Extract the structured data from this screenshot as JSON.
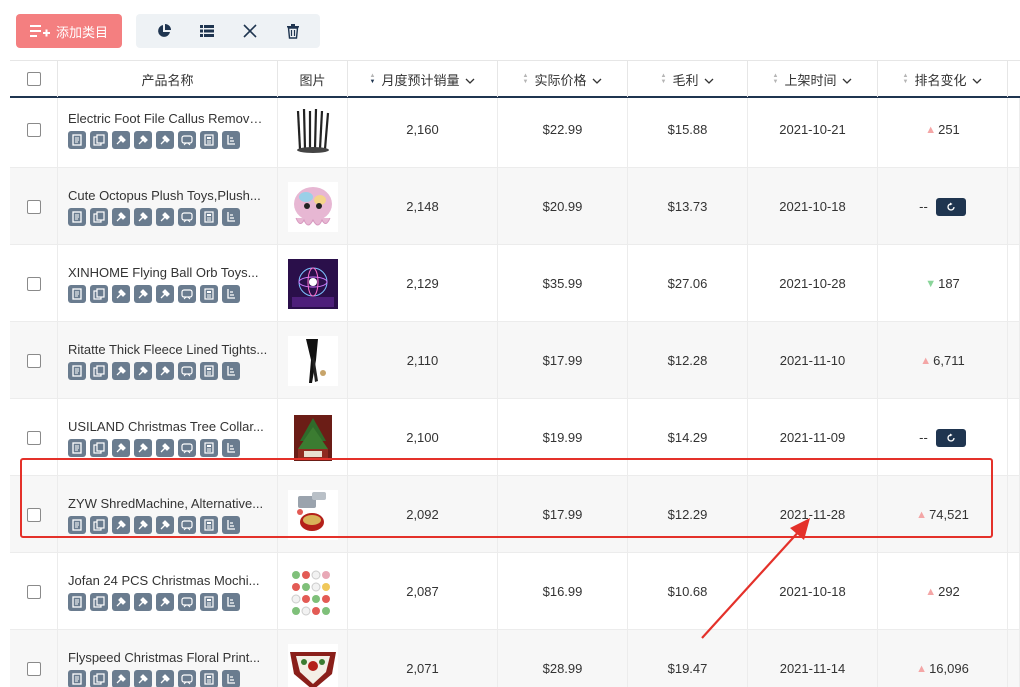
{
  "toolbar": {
    "add_label": "添加类目",
    "icons": [
      "pie-chart-icon",
      "list-icon",
      "close-icon",
      "trash-icon"
    ]
  },
  "table": {
    "headers": {
      "name": "产品名称",
      "image": "图片",
      "monthly_sales": "月度预计销量",
      "price": "实际价格",
      "gross_profit": "毛利",
      "listed_date": "上架时间",
      "rank_change": "排名变化"
    },
    "rows": [
      {
        "title": "Electric Foot File Callus Remover...",
        "sales": "2,160",
        "price": "$22.99",
        "profit": "$15.88",
        "date": "2021-10-21",
        "rank_dir": "up",
        "rank": "251",
        "img": "brushes"
      },
      {
        "title": "Cute Octopus Plush Toys,Plush...",
        "sales": "2,148",
        "price": "$20.99",
        "profit": "$13.73",
        "date": "2021-10-18",
        "rank_dir": "none",
        "rank": "--",
        "img": "plush"
      },
      {
        "title": "XINHOME Flying Ball Orb Toys...",
        "sales": "2,129",
        "price": "$35.99",
        "profit": "$27.06",
        "date": "2021-10-28",
        "rank_dir": "down",
        "rank": "187",
        "img": "orb"
      },
      {
        "title": "Ritatte Thick Fleece Lined Tights...",
        "sales": "2,110",
        "price": "$17.99",
        "profit": "$12.28",
        "date": "2021-11-10",
        "rank_dir": "up",
        "rank": "6,711",
        "img": "tights"
      },
      {
        "title": "USILAND Christmas Tree Collar...",
        "sales": "2,100",
        "price": "$19.99",
        "profit": "$14.29",
        "date": "2021-11-09",
        "rank_dir": "none",
        "rank": "--",
        "img": "tree"
      },
      {
        "title": "ZYW ShredMachine, Alternative...",
        "sales": "2,092",
        "price": "$17.99",
        "profit": "$12.29",
        "date": "2021-11-28",
        "rank_dir": "up",
        "rank": "74,521",
        "img": "shred"
      },
      {
        "title": "Jofan 24 PCS Christmas Mochi...",
        "sales": "2,087",
        "price": "$16.99",
        "profit": "$10.68",
        "date": "2021-10-18",
        "rank_dir": "up",
        "rank": "292",
        "img": "mochi"
      },
      {
        "title": "Flyspeed Christmas Floral Print...",
        "sales": "2,071",
        "price": "$28.99",
        "profit": "$19.47",
        "date": "2021-11-14",
        "rank_dir": "up",
        "rank": "16,096",
        "img": "floral"
      }
    ]
  },
  "colors": {
    "accent": "#1f3550",
    "add_button": "#f47f80",
    "highlight": "#e4312a",
    "rank_up": "#f4a6a6",
    "rank_down": "#8ad59a"
  }
}
